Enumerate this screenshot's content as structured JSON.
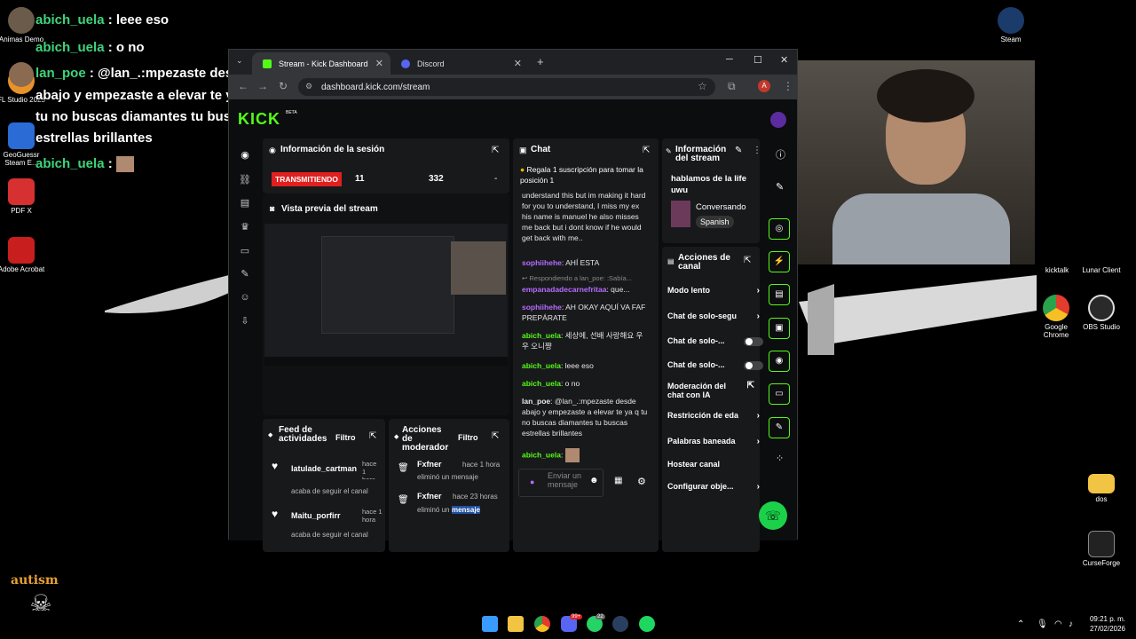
{
  "desktop": {
    "icons": [
      {
        "label": "Animas Demo",
        "color": "#6a5a46"
      },
      {
        "label": "FL Studio 2025",
        "color": "#e8922a"
      },
      {
        "label": "GeoGuessr Steam E...",
        "color": "#2a6bd6"
      },
      {
        "label": "PDF X",
        "color": "#d63030"
      },
      {
        "label": "Adobe Acrobat",
        "color": "#c81e1e"
      },
      {
        "label": "Steam",
        "color": "#1b3b6a"
      },
      {
        "label": "kicktalk",
        "color": "#333"
      },
      {
        "label": "Lunar Client",
        "color": "#444"
      },
      {
        "label": "Google Chrome",
        "color": "#3b8ae6"
      },
      {
        "label": "OBS Studio",
        "color": "#2a2a2a"
      },
      {
        "label": "dos",
        "color": "#f2c443"
      },
      {
        "label": "CurseForge",
        "color": "#222"
      }
    ],
    "watermark": "autism"
  },
  "overlay_chat": [
    {
      "user": "abich_uela",
      "text": ": leee eso"
    },
    {
      "user": "abich_uela",
      "text": ": o no"
    },
    {
      "user": "lan_poe",
      "text": ": @lan_.:mpezaste desde"
    },
    {
      "user": "",
      "text": "abajo y empezaste a elevar te ya q"
    },
    {
      "user": "",
      "text": "tu no buscas diamantes tu buscas"
    },
    {
      "user": "",
      "text": "estrellas brillantes"
    },
    {
      "user": "abich_uela",
      "text": ":"
    }
  ],
  "browser": {
    "tabs": [
      {
        "label": "Stream - Kick Dashboard",
        "fav": "#53fc18"
      },
      {
        "label": "Discord",
        "fav": "#5865f2"
      }
    ],
    "url": "dashboard.kick.com/stream",
    "avatar_letter": "A"
  },
  "dashboard": {
    "logo": "KICK",
    "logo_beta": "BETA",
    "session": {
      "title": "Información de la sesión",
      "status": "TRANSMITIENDO",
      "viewers": "11",
      "followers": "332",
      "dash": "-"
    },
    "preview": {
      "title": "Vista previa del stream"
    },
    "feed": {
      "title": "Feed de actividades",
      "filter": "Filtro",
      "items": [
        {
          "user": "latulade_cartman",
          "time": "hace 1 hora",
          "action": "acaba de seguir el canal"
        },
        {
          "user": "Maitu_porfirr",
          "time": "hace 1 hora",
          "action": "acaba de seguir el canal"
        }
      ]
    },
    "mod": {
      "title": "Acciones de moderador",
      "filter": "Filtro",
      "items": [
        {
          "user": "Fxfner",
          "time": "hace 1 hora",
          "action": "eliminó un mensaje"
        },
        {
          "user": "Fxfner",
          "time": "hace 23 horas",
          "action": "eliminó un",
          "highlight": "mensaje"
        }
      ]
    },
    "chat": {
      "title": "Chat",
      "pinned": "Regala 1 suscripción para tomar la posición 1",
      "messages": [
        {
          "user": "",
          "text": "understand this but im making it hard for you to understand, I miss my ex his name is manuel he also misses me back but i dont know if he would get back with me.."
        },
        {
          "user": "sophiihehe",
          "text": "AHÍ ESTA"
        },
        {
          "user": "",
          "text": "↩ Respondiendo a lan_poe: :Sabía..."
        },
        {
          "user": "empanadadecarnefritaa",
          "text": "que..."
        },
        {
          "user": "sophiihehe",
          "text": "AH OKAY AQUÍ VA FAF PREPÁRATE"
        },
        {
          "user": "abich_uela",
          "text": "세상에, 선배 사랑해요 우우 오니쨩"
        },
        {
          "user": "abich_uela",
          "text": "leee eso"
        },
        {
          "user": "abich_uela",
          "text": "o no"
        },
        {
          "user": "lan_poe",
          "text": "@lan_.:mpezaste desde abajo y empezaste a elevar te ya q tu no buscas diamantes tu buscas estrellas brillantes"
        },
        {
          "user": "abich_uela",
          "text": ""
        }
      ],
      "input_placeholder": "Enviar un mensaje"
    },
    "stream_info": {
      "title": "Información del stream",
      "stream_title": "hablamos de la life uwu",
      "category": "Conversando",
      "language": "Spanish"
    },
    "channel_actions": {
      "title": "Acciones de canal",
      "items": [
        {
          "label": "Modo lento",
          "kind": "chev"
        },
        {
          "label": "Chat de solo-segu",
          "kind": "chev"
        },
        {
          "label": "Chat de solo-...",
          "kind": "toggle"
        },
        {
          "label": "Chat de solo-...",
          "kind": "toggle"
        },
        {
          "label": "Moderación del chat con IA",
          "kind": "ext"
        },
        {
          "label": "Restricción de eda",
          "kind": "chev"
        },
        {
          "label": "Palabras baneada",
          "kind": "chev"
        },
        {
          "label": "Hostear canal",
          "kind": "none"
        },
        {
          "label": "Configurar obje...",
          "kind": "chev"
        }
      ]
    }
  },
  "taskbar": {
    "time": "09:21 p. m.",
    "date": "27/02/2026",
    "badge_discord": "99+",
    "badge_whatsapp": "22"
  }
}
